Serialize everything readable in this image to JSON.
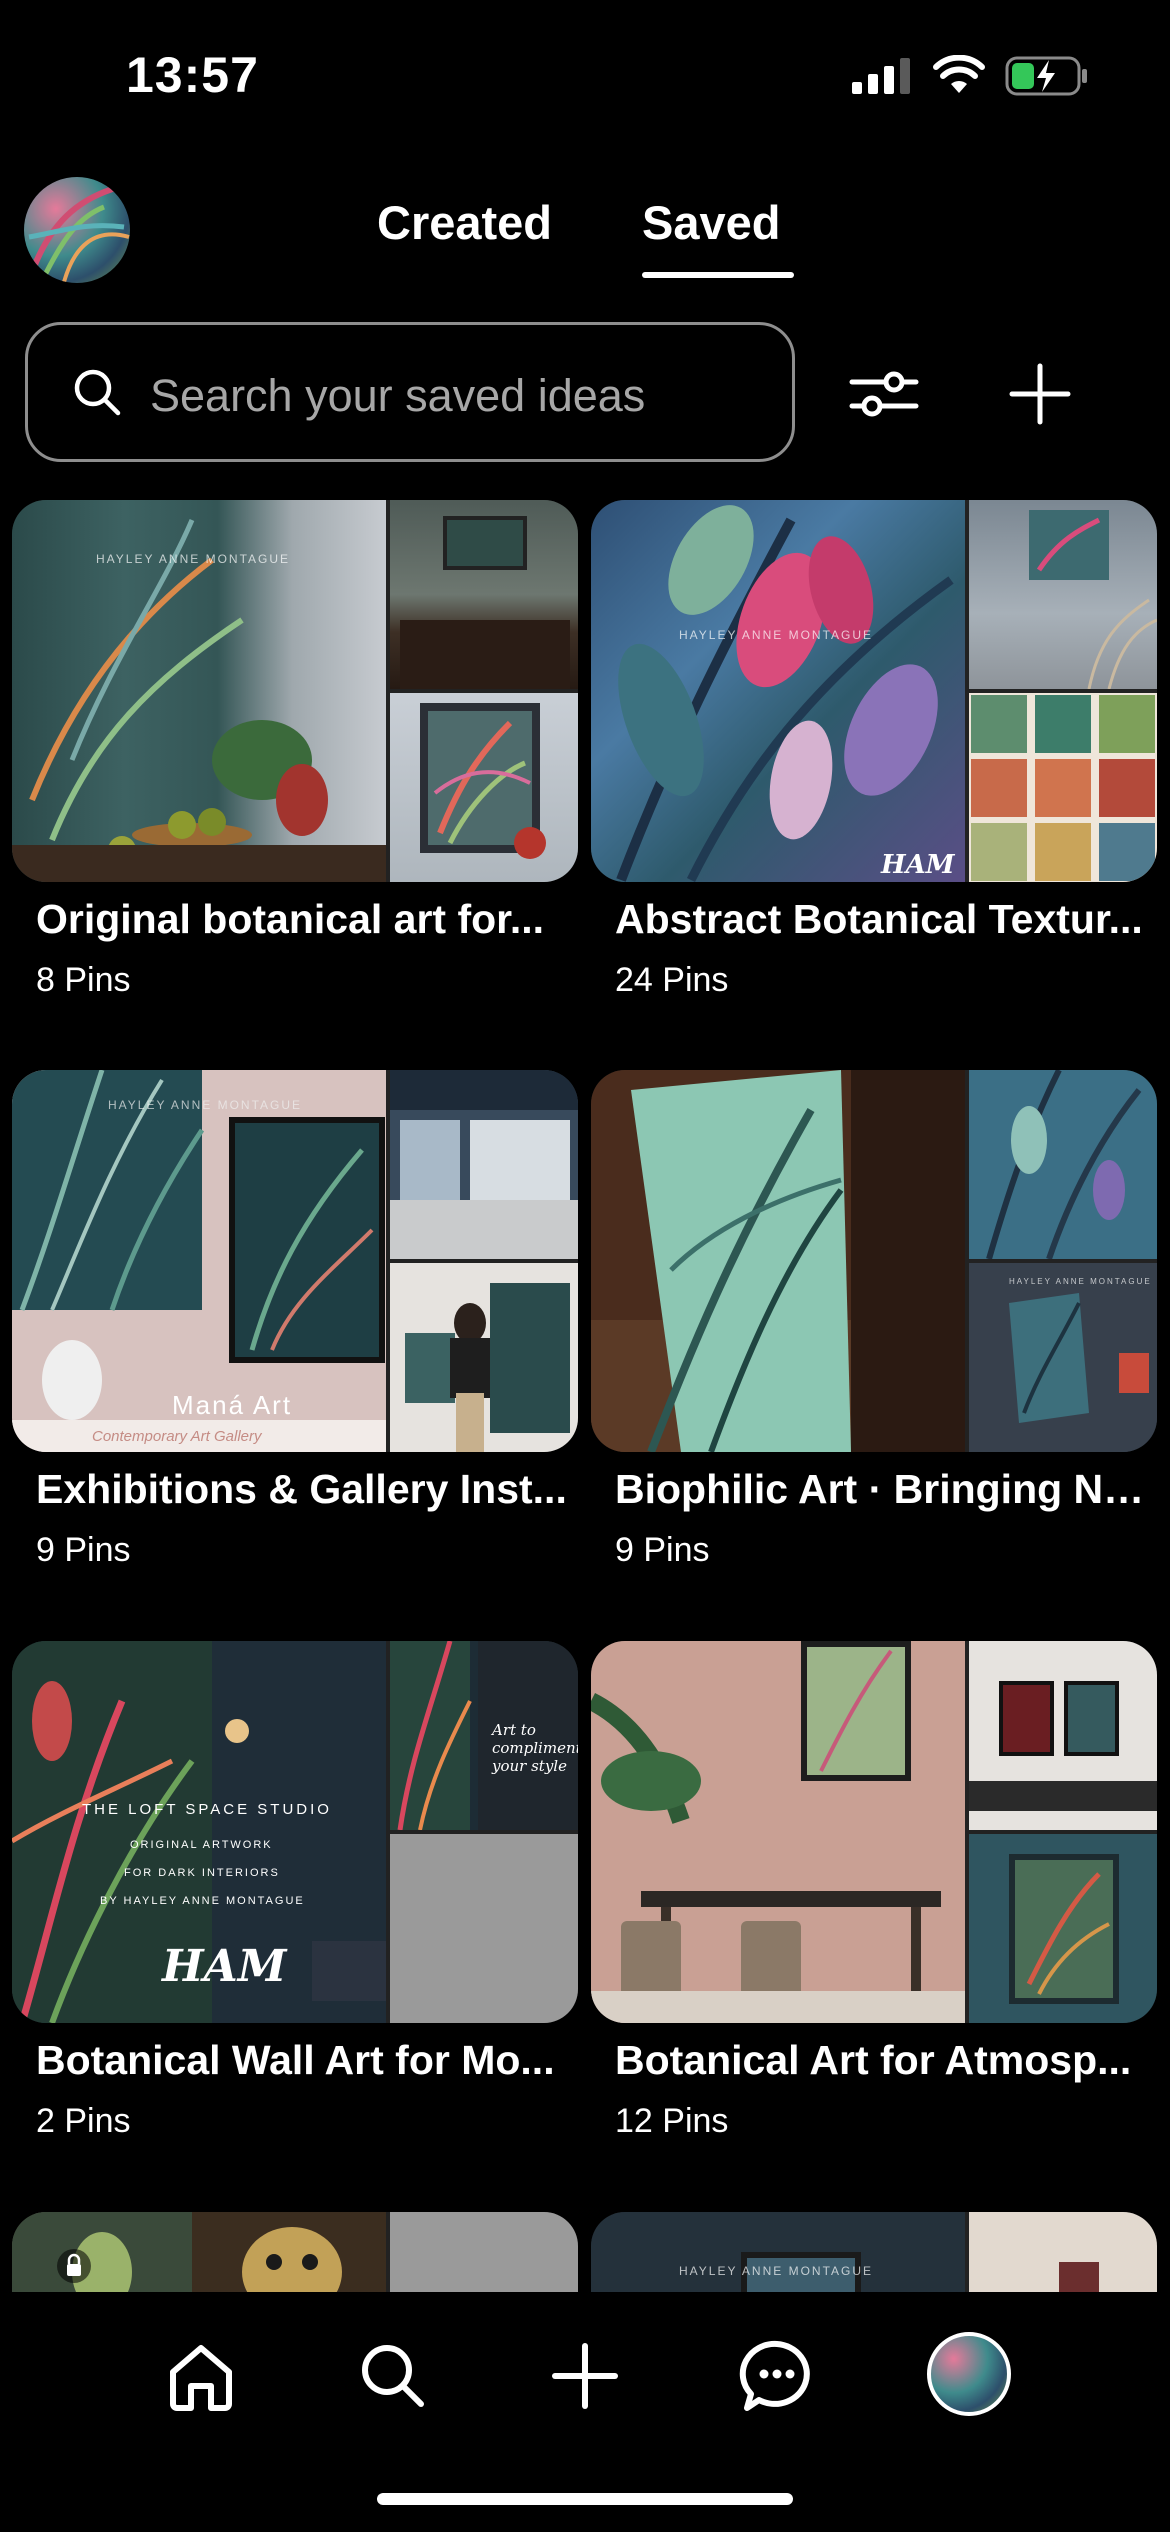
{
  "status": {
    "time": "13:57"
  },
  "header": {
    "tabs": [
      {
        "label": "Created"
      },
      {
        "label": "Saved"
      }
    ],
    "active_tab": "Saved"
  },
  "search": {
    "placeholder": "Search your saved ideas"
  },
  "boards": [
    {
      "title": "Original botanical art for...",
      "count": "8 Pins"
    },
    {
      "title": "Abstract Botanical Textur...",
      "count": "24 Pins"
    },
    {
      "title": "Exhibitions & Gallery Inst...",
      "count": "9 Pins"
    },
    {
      "title": "Biophilic Art · Bringing Na...",
      "count": "9 Pins"
    },
    {
      "title": "Botanical Wall Art for Mo...",
      "count": "2 Pins"
    },
    {
      "title": "Botanical Art for Atmosp...",
      "count": "12 Pins"
    }
  ],
  "cover_text": {
    "watermark": "HAYLEY ANNE MONTAGUE",
    "ham": "HAM",
    "mana_art": "Maná Art",
    "gallery_sub": "Contemporary Art Gallery",
    "loft_title": "THE LOFT SPACE STUDIO",
    "loft_line1": "ORIGINAL ARTWORK",
    "loft_line2": "FOR DARK INTERIORS",
    "loft_line3": "BY HAYLEY ANNE MONTAGUE",
    "art_to": "Art to compliment your style"
  },
  "nav": {
    "items": [
      "home-icon",
      "search-icon",
      "plus-icon",
      "messages-icon",
      "profile-avatar"
    ]
  },
  "colors": {
    "background": "#000000",
    "text": "#ffffff",
    "placeholder": "#a7a7a7",
    "border": "#8e8e8e"
  }
}
